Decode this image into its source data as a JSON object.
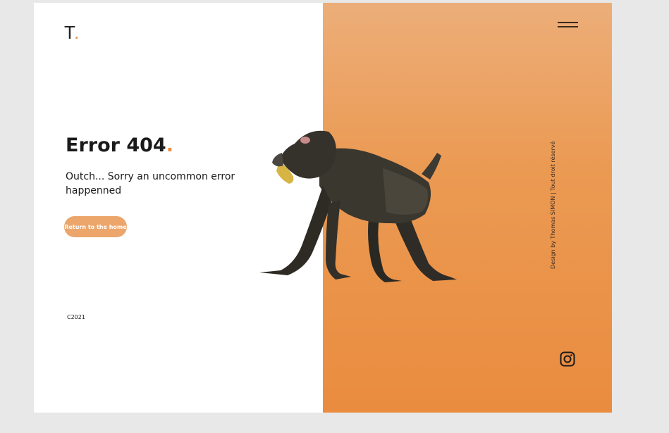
{
  "brand": {
    "logo_letter": "T",
    "logo_dot": "."
  },
  "error": {
    "headline": "Error 404",
    "headline_dot": ".",
    "message": "Outch... Sorry an uncommon error happenned"
  },
  "actions": {
    "return_home_label": "Return to the home"
  },
  "footer": {
    "copyright": "C2021"
  },
  "sidebar": {
    "credit": "Design by Thomas SIMON | Tout droit réservé"
  },
  "icons": {
    "menu": "hamburger-menu-icon",
    "social": "instagram-icon",
    "image": "mandrill-photo"
  },
  "colors": {
    "accent": "#ea8c3f",
    "panel_top": "#ecae79",
    "panel_bottom": "#ea8c3f",
    "button": "#eca56a",
    "text": "#1a1a1a"
  }
}
